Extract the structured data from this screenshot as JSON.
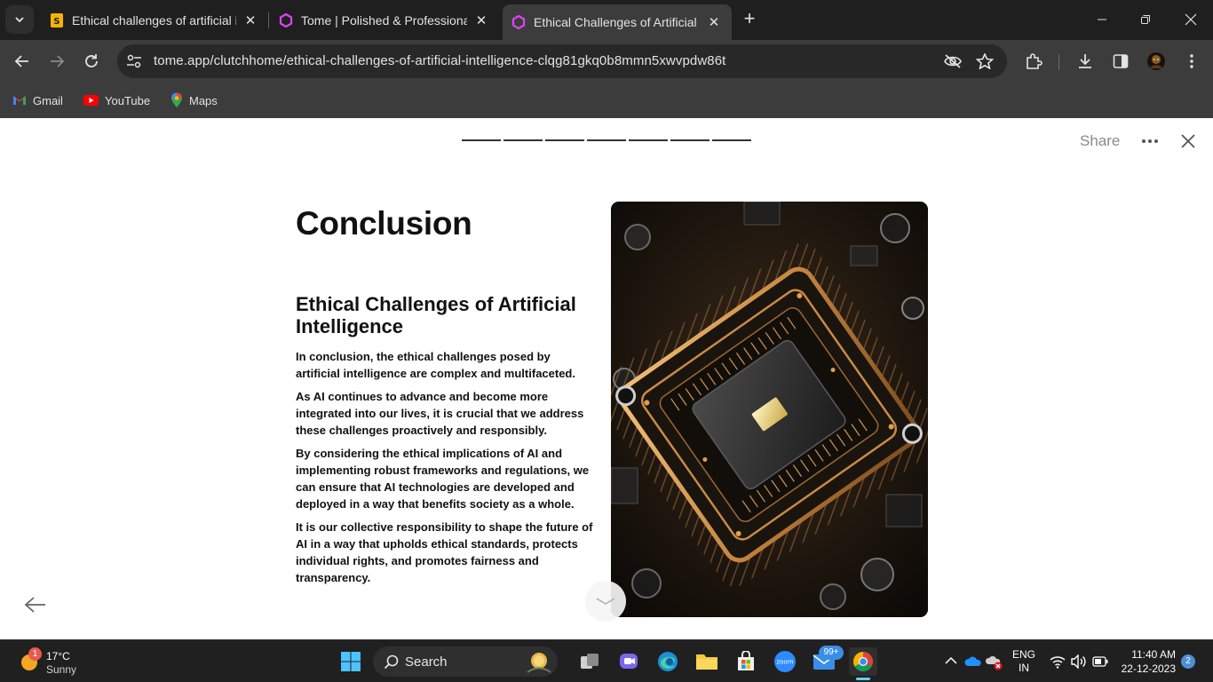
{
  "browser": {
    "tabs": [
      {
        "title": "Ethical challenges of artificial in",
        "favicon": "slides-icon",
        "active": false
      },
      {
        "title": "Tome | Polished & Professional",
        "favicon": "tome-icon",
        "active": false
      },
      {
        "title": "Ethical Challenges of Artificial In",
        "favicon": "tome-icon",
        "active": true
      }
    ],
    "address_bar": {
      "url": "tome.app/clutchhome/ethical-challenges-of-artificial-intelligence-clqg81gkq0b8mmn5xwvpdw86t"
    },
    "bookmarks": [
      {
        "label": "Gmail",
        "icon": "gmail-icon"
      },
      {
        "label": "YouTube",
        "icon": "youtube-icon"
      },
      {
        "label": "Maps",
        "icon": "maps-icon"
      }
    ]
  },
  "presentation": {
    "progress_segments": 7,
    "share_label": "Share",
    "slide": {
      "title": "Conclusion",
      "subtitle": "Ethical Challenges of Artificial Intelligence",
      "paragraphs": [
        "In conclusion, the ethical challenges posed by artificial intelligence are complex and multifaceted.",
        "As AI continues to advance and become more integrated into our lives, it is crucial that we address these challenges proactively and responsibly.",
        "By considering the ethical implications of AI and implementing robust frameworks and regulations, we can ensure that AI technologies are developed and deployed in a way that benefits society as a whole.",
        "It is our collective responsibility to shape the future of AI in a way that upholds ethical standards, protects individual rights, and promotes fairness and transparency."
      ],
      "image": "circuit-board-microchip-image"
    }
  },
  "taskbar": {
    "weather": {
      "temp": "17°C",
      "condition": "Sunny",
      "badge": "1"
    },
    "search_label": "Search",
    "mail_badge": "99+",
    "language": {
      "line1": "ENG",
      "line2": "IN"
    },
    "clock": {
      "time": "11:40 AM",
      "date": "22-12-2023"
    },
    "notification_count": "2"
  },
  "colors": {
    "chrome_dark": "#1f1f1f",
    "chrome_toolbar": "#3c3c3c",
    "tome_accent": "#d946ef",
    "taskbar": "#202020"
  }
}
